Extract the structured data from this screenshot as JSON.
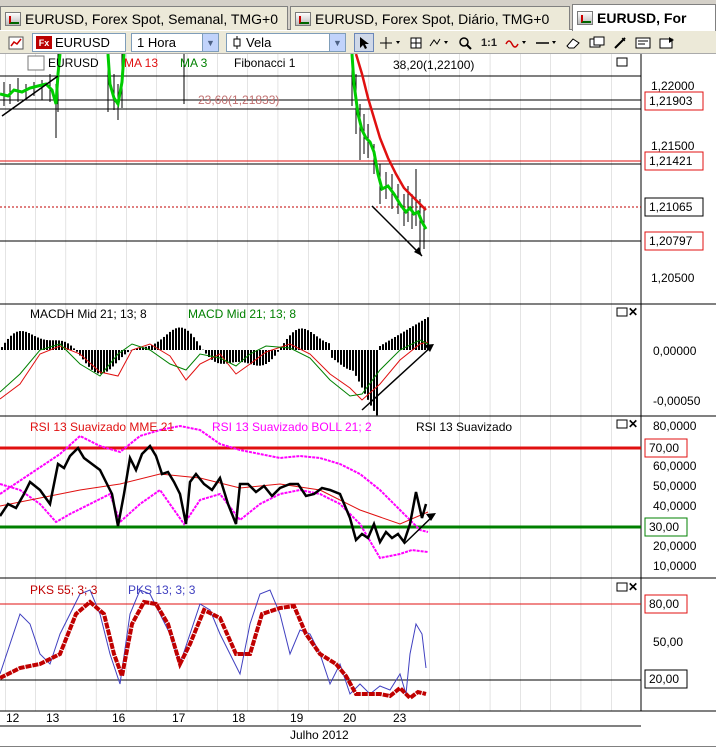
{
  "tabs": [
    {
      "label": "EURUSD, Forex Spot, Semanal, TMG+0",
      "active": false
    },
    {
      "label": "EURUSD, Forex Spot, Diário, TMG+0",
      "active": false
    },
    {
      "label": "EURUSD, For",
      "active": true
    }
  ],
  "toolbar": {
    "symbol": "EURUSD",
    "symbol_badge": "Fx",
    "timeframe": "1 Hora",
    "chart_type": "Vela",
    "tools": [
      "cursor-icon",
      "crosshair-icon",
      "data-window-icon",
      "zoom-icon",
      "one-to-one-icon",
      "fibonacci-icon",
      "hline-icon",
      "eraser-icon",
      "copy-icon",
      "draw-icon",
      "settings-icon",
      "export-icon"
    ],
    "one_to_one_label": "1:1"
  },
  "price_panel": {
    "legend": {
      "symbol": "EURUSD",
      "ma13": "MA 13",
      "ma3": "MA 3",
      "fib": "Fibonacci 1"
    },
    "fib_labels": {
      "f382": "38,20(1,22100)",
      "f236": "23,60(1,21833)"
    },
    "axis_ticks": [
      "1,22000",
      "1,21500",
      "1,20500"
    ],
    "price_boxes": [
      "1,21903",
      "1,21421",
      "1,21065",
      "1,20797"
    ]
  },
  "macd_panel": {
    "legend_hist": "MACDH Mid  21; 13; 8",
    "legend_line": "MACD Mid  21; 13; 8",
    "axis_ticks": [
      "0,00000",
      "-0,00050"
    ]
  },
  "rsi_panel": {
    "legend_mme": "RSI 13 Suavizado MME 21",
    "legend_boll": "RSI 13 Suavizado BOLL 21; 2",
    "legend_rsi": "RSI 13 Suavizado",
    "axis_ticks": [
      "80,0000",
      "60,0000",
      "50,0000",
      "40,0000",
      "20,0000",
      "10,0000"
    ],
    "level_boxes": [
      "70,00",
      "30,00"
    ]
  },
  "pks_panel": {
    "legend_55": "PKS 55; 3; 3",
    "legend_13": "PKS 13; 3; 3",
    "axis_ticks": [
      "50,00"
    ],
    "level_boxes": [
      "80,00",
      "20,00"
    ]
  },
  "time_axis": {
    "labels": [
      "12",
      "13",
      "16",
      "17",
      "18",
      "19",
      "20",
      "23"
    ],
    "month_label": "Julho 2012"
  },
  "colors": {
    "ma13": "#e01010",
    "ma3": "#00cc00",
    "macd_line": "#008000",
    "pks55": "#c00000",
    "pks13": "#4040c0",
    "boll": "#ff00ff",
    "level_green": "#008000",
    "level_red": "#e01010"
  }
}
